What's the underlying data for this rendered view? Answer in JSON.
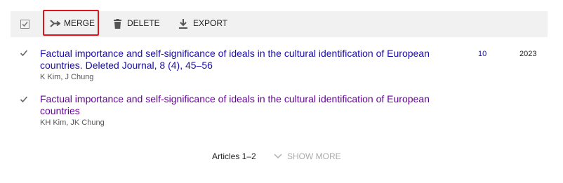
{
  "colors": {
    "toolbar_bg": "#f1f1f1",
    "highlight_border": "#e0141e",
    "link": "#1a0dab",
    "visited_link": "#660099",
    "muted": "#aaaaaa"
  },
  "toolbar": {
    "merge_label": "MERGE",
    "delete_label": "DELETE",
    "export_label": "EXPORT",
    "icons": [
      "checkbox-icon",
      "merge-icon",
      "trash-icon",
      "download-icon"
    ]
  },
  "articles": [
    {
      "title_line1": "Factual importance and self-significance of ideals in the cultural identification of European",
      "title_line2": "countries. Deleted Journal, 8 (4), 45–56",
      "authors": "K Kim, J Chung",
      "cited_by": "10",
      "year": "2023",
      "checked": true
    },
    {
      "title_line1": "Factual importance and self-significance of ideals in the cultural identification of European",
      "title_line2": "countries",
      "authors": "KH Kim, JK Chung",
      "cited_by": "",
      "year": "",
      "checked": true
    }
  ],
  "footer": {
    "range": "Articles 1–2",
    "show_more": "SHOW MORE"
  }
}
